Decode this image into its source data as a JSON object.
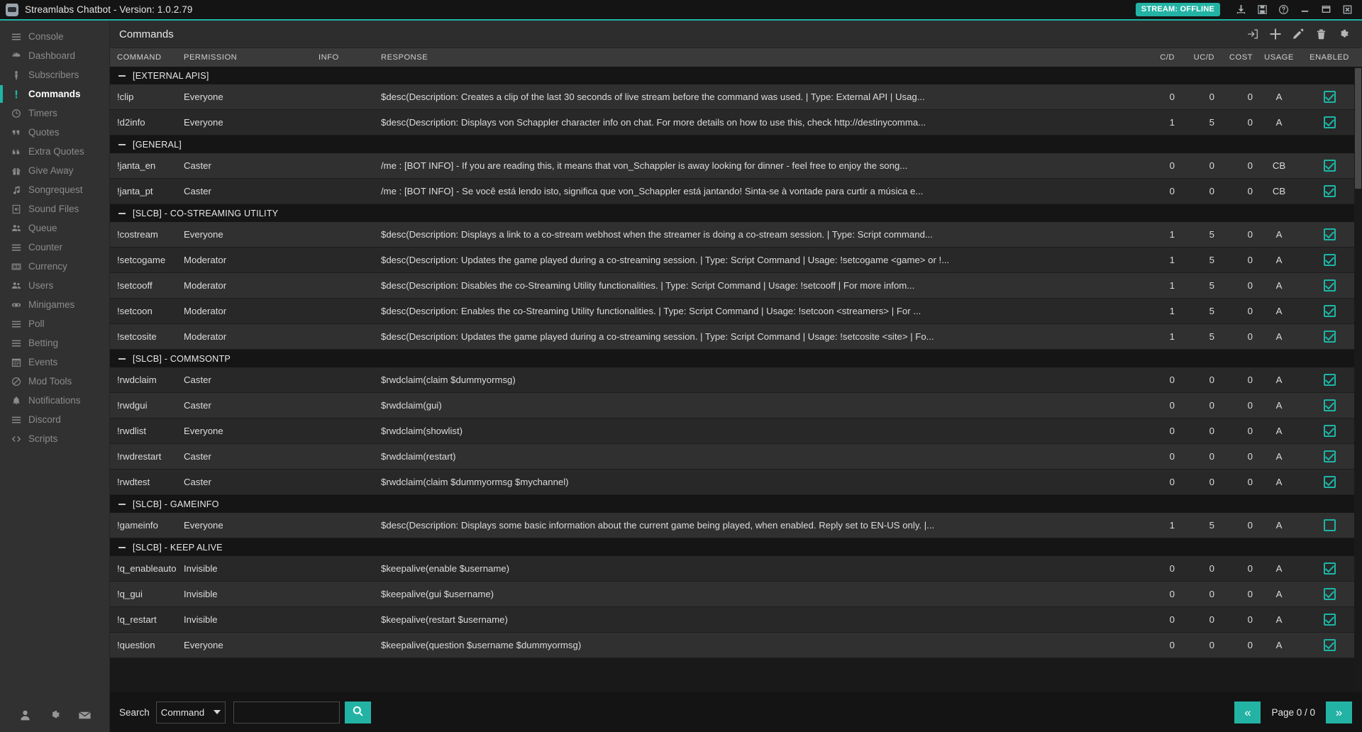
{
  "titlebar": {
    "title": "Streamlabs Chatbot - Version: 1.0.2.79",
    "stream_status": "STREAM: OFFLINE",
    "icons": [
      "download-icon",
      "save-icon",
      "help-icon",
      "minimize-icon",
      "maximize-icon",
      "close-icon"
    ],
    "accent": "#1db5a6"
  },
  "sidebar": {
    "items": [
      {
        "label": "Console",
        "icon": "list-icon",
        "active": false
      },
      {
        "label": "Dashboard",
        "icon": "gauge-icon",
        "active": false
      },
      {
        "label": "Subscribers",
        "icon": "person-icon",
        "active": false
      },
      {
        "label": "Commands",
        "icon": "exclamation-icon",
        "active": true
      },
      {
        "label": "Timers",
        "icon": "clock-icon",
        "active": false
      },
      {
        "label": "Quotes",
        "icon": "quote-right-icon",
        "active": false
      },
      {
        "label": "Extra Quotes",
        "icon": "quote-left-icon",
        "active": false
      },
      {
        "label": "Give Away",
        "icon": "gift-icon",
        "active": false
      },
      {
        "label": "Songrequest",
        "icon": "music-note-icon",
        "active": false
      },
      {
        "label": "Sound Files",
        "icon": "speaker-file-icon",
        "active": false
      },
      {
        "label": "Queue",
        "icon": "users-icon",
        "active": false
      },
      {
        "label": "Counter",
        "icon": "list-icon",
        "active": false
      },
      {
        "label": "Currency",
        "icon": "money-icon",
        "active": false
      },
      {
        "label": "Users",
        "icon": "users-icon",
        "active": false
      },
      {
        "label": "Minigames",
        "icon": "gamepad-icon",
        "active": false
      },
      {
        "label": "Poll",
        "icon": "list-icon",
        "active": false
      },
      {
        "label": "Betting",
        "icon": "list-icon",
        "active": false
      },
      {
        "label": "Events",
        "icon": "calendar-icon",
        "active": false
      },
      {
        "label": "Mod Tools",
        "icon": "ban-icon",
        "active": false
      },
      {
        "label": "Notifications",
        "icon": "bell-icon",
        "active": false
      },
      {
        "label": "Discord",
        "icon": "list-icon",
        "active": false
      },
      {
        "label": "Scripts",
        "icon": "code-icon",
        "active": false
      }
    ],
    "footer_icons": [
      "account-icon",
      "settings-gear-icon",
      "mail-icon"
    ]
  },
  "page": {
    "title": "Commands",
    "toolbar_icons": [
      "import-icon",
      "add-icon",
      "edit-icon",
      "delete-icon",
      "settings-icon"
    ]
  },
  "table": {
    "columns": [
      "COMMAND",
      "PERMISSION",
      "INFO",
      "RESPONSE",
      "C/D",
      "UC/D",
      "COST",
      "USAGE",
      "ENABLED"
    ],
    "groups": [
      {
        "title": "[EXTERNAL APIS]",
        "rows": [
          {
            "command": "!clip",
            "permission": "Everyone",
            "info": "",
            "response": "$desc(Description: Creates a clip of the last 30 seconds of live stream before the command was used. | Type: External API | Usag...",
            "cd": "0",
            "ucd": "0",
            "cost": "0",
            "usage": "A",
            "enabled": true
          },
          {
            "command": "!d2info",
            "permission": "Everyone",
            "info": "",
            "response": "$desc(Description: Displays von Schappler character info on chat. For more details on how to use this, check http://destinycomma...",
            "cd": "1",
            "ucd": "5",
            "cost": "0",
            "usage": "A",
            "enabled": true
          }
        ]
      },
      {
        "title": "[GENERAL]",
        "rows": [
          {
            "command": "!janta_en",
            "permission": "Caster",
            "info": "",
            "response": "/me : [BOT INFO] - If you are reading this, it means that von_Schappler is away looking for dinner - feel free to enjoy the song...",
            "cd": "0",
            "ucd": "0",
            "cost": "0",
            "usage": "CB",
            "enabled": true
          },
          {
            "command": "!janta_pt",
            "permission": "Caster",
            "info": "",
            "response": "/me : [BOT INFO] - Se você está lendo isto, significa que von_Schappler está jantando! Sinta-se à vontade para curtir a música e...",
            "cd": "0",
            "ucd": "0",
            "cost": "0",
            "usage": "CB",
            "enabled": true
          }
        ]
      },
      {
        "title": "[SLCB] - CO-STREAMING UTILITY",
        "rows": [
          {
            "command": "!costream",
            "permission": "Everyone",
            "info": "",
            "response": "$desc(Description: Displays a link to a co-stream webhost when the streamer is doing a co-stream session. | Type: Script command...",
            "cd": "1",
            "ucd": "5",
            "cost": "0",
            "usage": "A",
            "enabled": true
          },
          {
            "command": "!setcogame",
            "permission": "Moderator",
            "info": "",
            "response": "$desc(Description: Updates the game played during a co-streaming session. | Type: Script Command | Usage: !setcogame <game> or !...",
            "cd": "1",
            "ucd": "5",
            "cost": "0",
            "usage": "A",
            "enabled": true
          },
          {
            "command": "!setcooff",
            "permission": "Moderator",
            "info": "",
            "response": "$desc(Description: Disables the co-Streaming Utility functionalities. | Type: Script Command | Usage: !setcooff | For more infom...",
            "cd": "1",
            "ucd": "5",
            "cost": "0",
            "usage": "A",
            "enabled": true
          },
          {
            "command": "!setcoon",
            "permission": "Moderator",
            "info": "",
            "response": "$desc(Description: Enables the co-Streaming Utility functionalities. | Type: Script Command | Usage: !setcoon <streamers> | For ...",
            "cd": "1",
            "ucd": "5",
            "cost": "0",
            "usage": "A",
            "enabled": true
          },
          {
            "command": "!setcosite",
            "permission": "Moderator",
            "info": "",
            "response": "$desc(Description: Updates the game played during a co-streaming session. | Type: Script Command | Usage: !setcosite <site> | Fo...",
            "cd": "1",
            "ucd": "5",
            "cost": "0",
            "usage": "A",
            "enabled": true
          }
        ]
      },
      {
        "title": "[SLCB] - COMMSONTP",
        "rows": [
          {
            "command": "!rwdclaim",
            "permission": "Caster",
            "info": "",
            "response": "$rwdclaim(claim $dummyormsg)",
            "cd": "0",
            "ucd": "0",
            "cost": "0",
            "usage": "A",
            "enabled": true
          },
          {
            "command": "!rwdgui",
            "permission": "Caster",
            "info": "",
            "response": "$rwdclaim(gui)",
            "cd": "0",
            "ucd": "0",
            "cost": "0",
            "usage": "A",
            "enabled": true
          },
          {
            "command": "!rwdlist",
            "permission": "Everyone",
            "info": "",
            "response": "$rwdclaim(showlist)",
            "cd": "0",
            "ucd": "0",
            "cost": "0",
            "usage": "A",
            "enabled": true
          },
          {
            "command": "!rwdrestart",
            "permission": "Caster",
            "info": "",
            "response": "$rwdclaim(restart)",
            "cd": "0",
            "ucd": "0",
            "cost": "0",
            "usage": "A",
            "enabled": true
          },
          {
            "command": "!rwdtest",
            "permission": "Caster",
            "info": "",
            "response": "$rwdclaim(claim $dummyormsg $mychannel)",
            "cd": "0",
            "ucd": "0",
            "cost": "0",
            "usage": "A",
            "enabled": true
          }
        ]
      },
      {
        "title": "[SLCB] - GAMEINFO",
        "rows": [
          {
            "command": "!gameinfo",
            "permission": "Everyone",
            "info": "",
            "response": "$desc(Description: Displays some basic information about the current game being played, when enabled. Reply set to EN-US only. |...",
            "cd": "1",
            "ucd": "5",
            "cost": "0",
            "usage": "A",
            "enabled": false
          }
        ]
      },
      {
        "title": "[SLCB] - KEEP ALIVE",
        "rows": [
          {
            "command": "!q_enableauto",
            "permission": "Invisible",
            "info": "",
            "response": "$keepalive(enable $username)",
            "cd": "0",
            "ucd": "0",
            "cost": "0",
            "usage": "A",
            "enabled": true
          },
          {
            "command": "!q_gui",
            "permission": "Invisible",
            "info": "",
            "response": "$keepalive(gui $username)",
            "cd": "0",
            "ucd": "0",
            "cost": "0",
            "usage": "A",
            "enabled": true
          },
          {
            "command": "!q_restart",
            "permission": "Invisible",
            "info": "",
            "response": "$keepalive(restart $username)",
            "cd": "0",
            "ucd": "0",
            "cost": "0",
            "usage": "A",
            "enabled": true
          },
          {
            "command": "!question",
            "permission": "Everyone",
            "info": "",
            "response": "$keepalive(question $username $dummyormsg)",
            "cd": "0",
            "ucd": "0",
            "cost": "0",
            "usage": "A",
            "enabled": true
          }
        ]
      }
    ]
  },
  "footer": {
    "search_label": "Search",
    "search_type": "Command",
    "search_value": "",
    "search_placeholder": "",
    "search_button_icon": "search-icon",
    "prev_label": "«",
    "next_label": "»",
    "page_label": "Page 0 / 0"
  }
}
